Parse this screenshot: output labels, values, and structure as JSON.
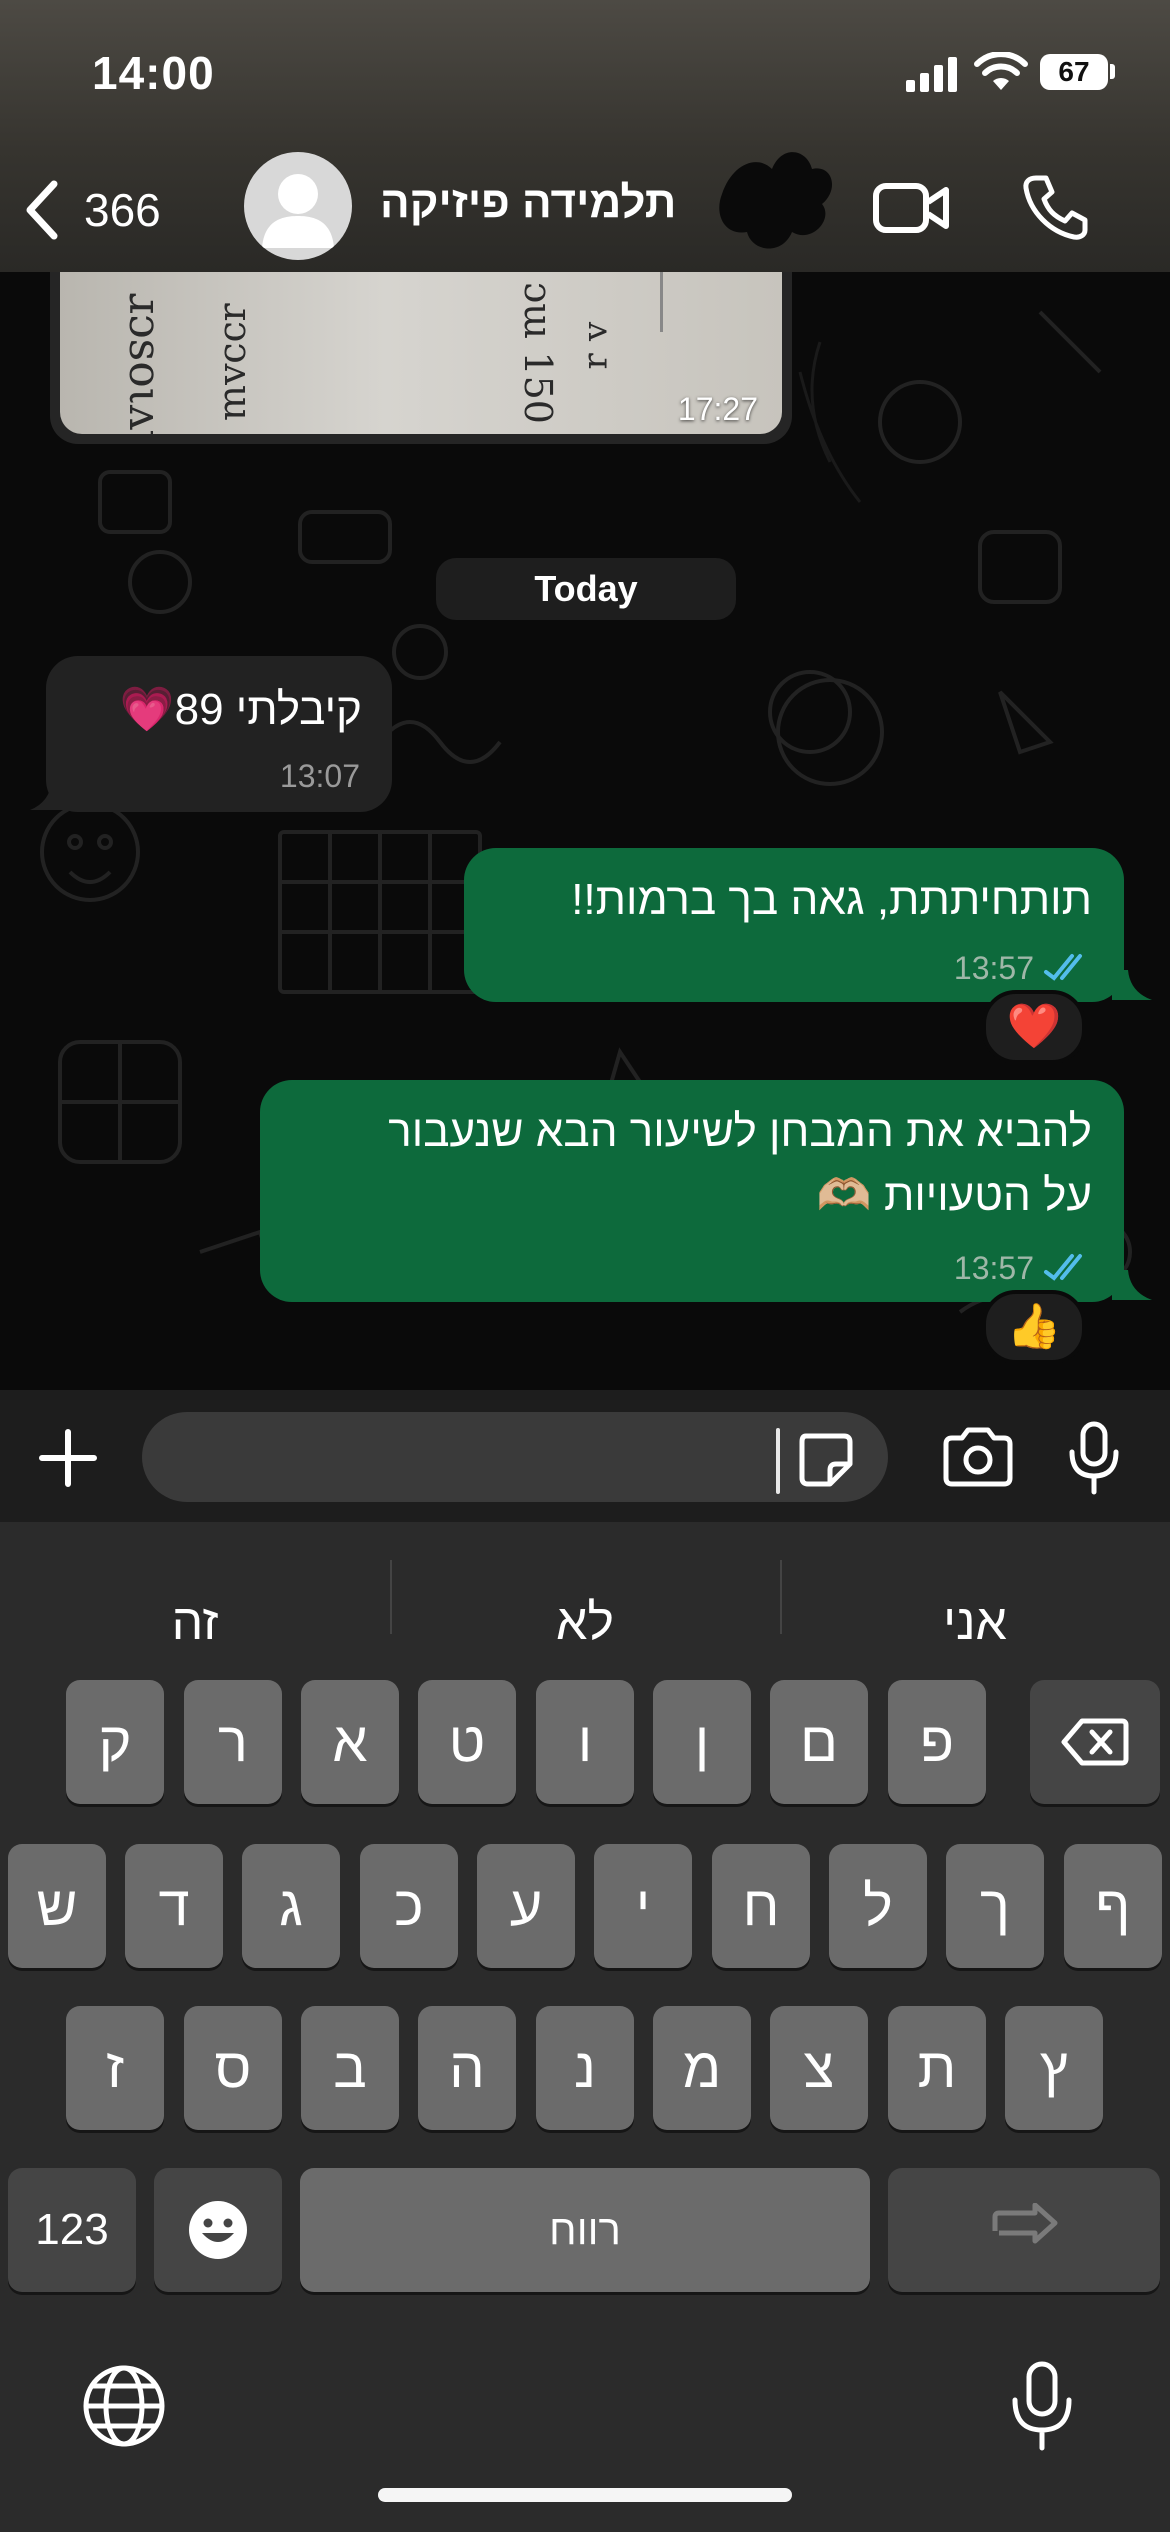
{
  "status_bar": {
    "time": "14:00",
    "battery": "67"
  },
  "header": {
    "back_count": "366",
    "contact_name": "תלמידה פיזיקה"
  },
  "chat": {
    "image_message": {
      "time": "17:27"
    },
    "date_separator": "Today",
    "messages": [
      {
        "direction": "incoming",
        "text": "קיבלתי 89",
        "emoji": "💗",
        "time": "13:07"
      },
      {
        "direction": "outgoing",
        "text": "תותחיתתת, גאה בך ברמות!!",
        "time": "13:57",
        "status": "read",
        "reaction": "❤️"
      },
      {
        "direction": "outgoing",
        "line1": "להביא את המבחן לשיעור הבא שנעבור",
        "line2": "על הטעויות",
        "emoji": "🫶🏼",
        "time": "13:57",
        "status": "read",
        "reaction": "👍"
      }
    ]
  },
  "input": {
    "placeholder": ""
  },
  "keyboard": {
    "suggestions": [
      "אני",
      "לא",
      "זה"
    ],
    "row1": [
      "ק",
      "ר",
      "א",
      "ט",
      "ו",
      "ן",
      "ם",
      "פ"
    ],
    "row2": [
      "ש",
      "ד",
      "ג",
      "כ",
      "ע",
      "י",
      "ח",
      "ל",
      "ך",
      "ף"
    ],
    "row3": [
      "ז",
      "ס",
      "ב",
      "ה",
      "נ",
      "מ",
      "צ",
      "ת",
      "ץ"
    ],
    "num_label": "123",
    "space_label": "רווח"
  },
  "colors": {
    "outgoing_bubble": "#0d6a3c",
    "incoming_bubble": "#222222",
    "read_ticks": "#53bdeb"
  },
  "icons": [
    "back-chevron-icon",
    "avatar-icon",
    "video-call-icon",
    "phone-icon",
    "plus-icon",
    "sticker-icon",
    "camera-icon",
    "mic-icon",
    "backspace-icon",
    "emoji-icon",
    "return-icon",
    "globe-icon",
    "dictation-icon"
  ]
}
